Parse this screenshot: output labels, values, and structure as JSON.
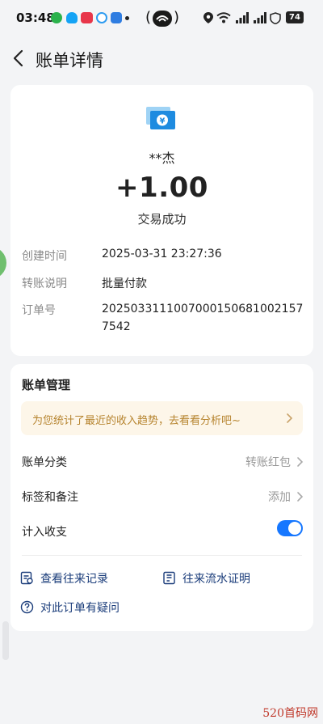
{
  "status_bar": {
    "time": "03:48",
    "battery": "74",
    "icons": [
      "wechat-icon",
      "qq-icon",
      "app-icon",
      "app-icon",
      "app-icon",
      "location-icon",
      "wifi-icon",
      "signal-icon",
      "signal-icon",
      "shield-icon",
      "battery-icon"
    ]
  },
  "header": {
    "title": "账单详情",
    "back_icon": "chevron-left-icon"
  },
  "transaction": {
    "icon": "transfer-icon",
    "counterparty": "**杰",
    "amount": "+1.00",
    "status": "交易成功"
  },
  "details": [
    {
      "label": "创建时间",
      "value": "2025-03-31 23:27:36"
    },
    {
      "label": "转账说明",
      "value": "批量付款"
    },
    {
      "label": "订单号",
      "value": "20250331110070001506810021577542"
    }
  ],
  "management": {
    "title": "账单管理",
    "trend_banner": "为您统计了最近的收入趋势，去看看分析吧~",
    "category_label": "账单分类",
    "category_value": "转账红包",
    "tags_label": "标签和备注",
    "tags_value": "添加",
    "income_label": "计入收支",
    "income_enabled": true,
    "links": [
      {
        "label": "查看往来记录",
        "icon": "record-icon"
      },
      {
        "label": "往来流水证明",
        "icon": "certificate-icon"
      },
      {
        "label": "对此订单有疑问",
        "icon": "question-icon"
      }
    ]
  },
  "colors": {
    "accent": "#1677ff",
    "link": "#1a3c7a",
    "banner_bg": "#fdf6e9",
    "banner_text": "#b6842f",
    "page_bg": "#f3f4f6"
  },
  "watermark": "520首码网"
}
